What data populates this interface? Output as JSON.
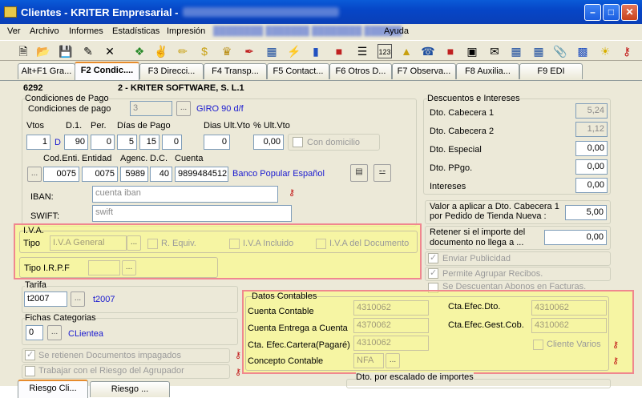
{
  "window": {
    "title": "Clientes - KRITER Empresarial -"
  },
  "menu": [
    "Ver",
    "Archivo",
    "Informes",
    "Estadísticas",
    "Impresión",
    "Ayuda"
  ],
  "tabs": [
    "Alt+F1 Gra...",
    "F2 Condic....",
    "F3 Direcci...",
    "F4 Transp...",
    "F5 Contact...",
    "F6 Otros D...",
    "F7 Observa...",
    "F8 Auxilia...",
    "F9 EDI"
  ],
  "header": {
    "code": "6292",
    "name": "2 - KRITER SOFTWARE, S. L.1"
  },
  "conditions": {
    "title": "Condiciones de Pago",
    "cond_label": "Condiciones de pago",
    "cond_value": "3",
    "cond_desc": "GIRO 90 d/f",
    "vtos_label": "Vtos",
    "d1_label": "D.1.",
    "per_label": "Per.",
    "dias_label": "Días de Pago",
    "dias_ult_label": "Dias Ult.Vto",
    "pct_label": "% Ult.Vto",
    "vtos": "1",
    "vtos_unit": "D",
    "d1": "90",
    "per": "0",
    "dia1": "5",
    "dia2": "15",
    "dia3": "0",
    "dias_ult": "0",
    "pct": "0,00",
    "con_domicilio": "Con domicilio",
    "cod_enti_label": "Cod.Enti.",
    "entidad_label": "Entidad",
    "agenc_label": "Agenc.",
    "dc_label": "D.C.",
    "cuenta_label": "Cuenta",
    "cod_enti": "0075",
    "entidad": "0075",
    "agenc": "5989",
    "dc": "40",
    "cuenta": "9899484512",
    "banco": "Banco Popular Español",
    "iban_label": "IBAN:",
    "iban": "cuenta iban",
    "swift_label": "SWIFT:",
    "swift": "swift"
  },
  "iva": {
    "title": "I.V.A.",
    "tipo_label": "Tipo",
    "tipo_value": "I.V.A General",
    "requiv": "R. Equiv.",
    "incluido": "I.V.A Incluido",
    "del_doc": "I.V.A del Documento",
    "irpf_label": "Tipo I.R.P.F"
  },
  "tarifa": {
    "title": "Tarifa",
    "value": "t2007",
    "desc": "t2007"
  },
  "fichas": {
    "title": "Fichas Categorias",
    "value": "0",
    "desc": "CLientea"
  },
  "checks": {
    "retienen": "Se retienen Documentos impagados",
    "riesgo": "Trabajar con el Riesgo del Agrupador"
  },
  "bottom_tabs": [
    "Riesgo Cli...",
    "Riesgo ..."
  ],
  "descuentos": {
    "title": "Descuentos e Intereses",
    "items": [
      {
        "label": "Dto. Cabecera 1",
        "value": "5,24"
      },
      {
        "label": "Dto. Cabecera 2",
        "value": "1,12"
      },
      {
        "label": "Dto. Especial",
        "value": "0,00"
      },
      {
        "label": "Dto. PPgo.",
        "value": "0,00"
      },
      {
        "label": "Intereses",
        "value": "0,00"
      }
    ]
  },
  "valor": {
    "label1": "Valor a aplicar a Dto. Cabecera 1",
    "label2": "por Pedido de Tienda Nueva :",
    "value": "5,00"
  },
  "retener": {
    "label1": "Retener si el importe del",
    "label2": "documento no llega a ...",
    "value": "0,00"
  },
  "flags": {
    "enviar": "Enviar Publicidad",
    "agrupar": "Permite Agrupar Recibos.",
    "abonos": "Se Descuentan Abonos en Facturas."
  },
  "contables": {
    "title": "Datos Contables",
    "cuenta_contable_label": "Cuenta Contable",
    "cuenta_contable": "4310062",
    "entrega_label": "Cuenta Entrega a Cuenta",
    "entrega": "4370062",
    "cartera_label": "Cta. Efec.Cartera(Pagaré)",
    "cartera": "4310062",
    "concepto_label": "Concepto Contable",
    "concepto": "NFA",
    "efec_dto_label": "Cta.Efec.Dto.",
    "efec_dto": "4310062",
    "gest_label": "Cta.Efec.Gest.Cob.",
    "gest": "4310062",
    "cliente_varios": "Cliente Varios"
  },
  "escalado": {
    "title": "Dto. por escalado de importes"
  },
  "colors": {
    "titlebar": "#0a5bd8",
    "panel": "#ece9d8",
    "highlight": "#f0878f",
    "hl_fill": "#ffff78"
  }
}
